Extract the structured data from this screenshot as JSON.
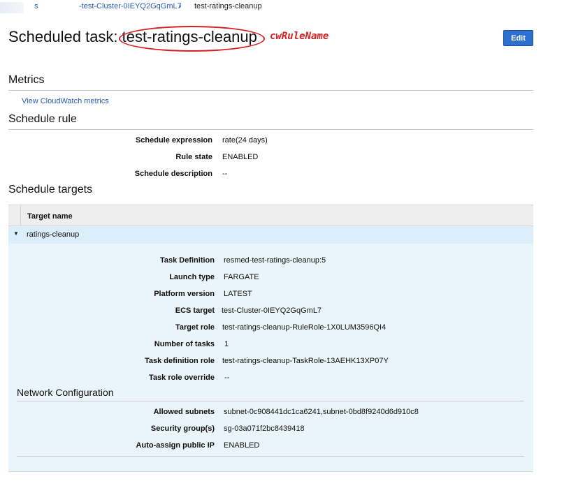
{
  "breadcrumb": {
    "prefix": "s",
    "cluster": "-test-Cluster-0IEYQ2GqGmL7",
    "separator": "›",
    "current": "test-ratings-cleanup"
  },
  "header": {
    "title_prefix": "Scheduled task: ",
    "title_name": "test-ratings-cleanup",
    "annotation_label": "cwRuleName",
    "annotation_color": "#d62020",
    "edit_label": "Edit"
  },
  "metrics": {
    "heading": "Metrics",
    "link": "View CloudWatch metrics"
  },
  "schedule_rule": {
    "heading": "Schedule rule",
    "rows": [
      {
        "label": "Schedule expression",
        "value": "rate(24 days)"
      },
      {
        "label": "Rule state",
        "value": "ENABLED"
      },
      {
        "label": "Schedule description",
        "value": "--"
      }
    ]
  },
  "schedule_targets": {
    "heading": "Schedule targets",
    "column_header": "Target name",
    "target": {
      "name": "ratings-cleanup",
      "details": [
        {
          "label": "Task Definition",
          "value": "resmed-test-ratings-cleanup:5"
        },
        {
          "label": "Launch type",
          "value": "FARGATE"
        },
        {
          "label": "Platform version",
          "value": "LATEST"
        },
        {
          "label": "ECS target",
          "value": "test-Cluster-0IEYQ2GqGmL7"
        },
        {
          "label": "Target role",
          "value": "test-ratings-cleanup-RuleRole-1X0LUM3596QI4"
        },
        {
          "label": "Number of tasks",
          "value": "1"
        },
        {
          "label": "Task definition role",
          "value": "test-ratings-cleanup-TaskRole-13AEHK13XP07Y"
        },
        {
          "label": "Task role override",
          "value": "--"
        }
      ],
      "network": {
        "heading": "Network Configuration",
        "rows": [
          {
            "label": "Allowed subnets",
            "value": "subnet-0c908441dc1ca6241,subnet-0bd8f9240d6d910c8"
          },
          {
            "label": "Security group(s)",
            "value": "sg-03a071f2bc8439418"
          },
          {
            "label": "Auto-assign public IP",
            "value": "ENABLED"
          }
        ]
      }
    }
  }
}
